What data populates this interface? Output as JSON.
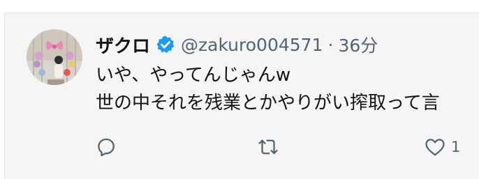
{
  "tweet": {
    "display_name": "ザクロ",
    "verified": true,
    "handle": "@zakuro004571",
    "separator": "·",
    "time": "36分",
    "lines": [
      "いや、やってんじゃんw",
      "世の中それを残業とかやりがい搾取って言"
    ],
    "actions": {
      "reply_count": "",
      "retweet_count": "",
      "like_count": "1"
    },
    "accent_color": "#1d9bf0"
  }
}
